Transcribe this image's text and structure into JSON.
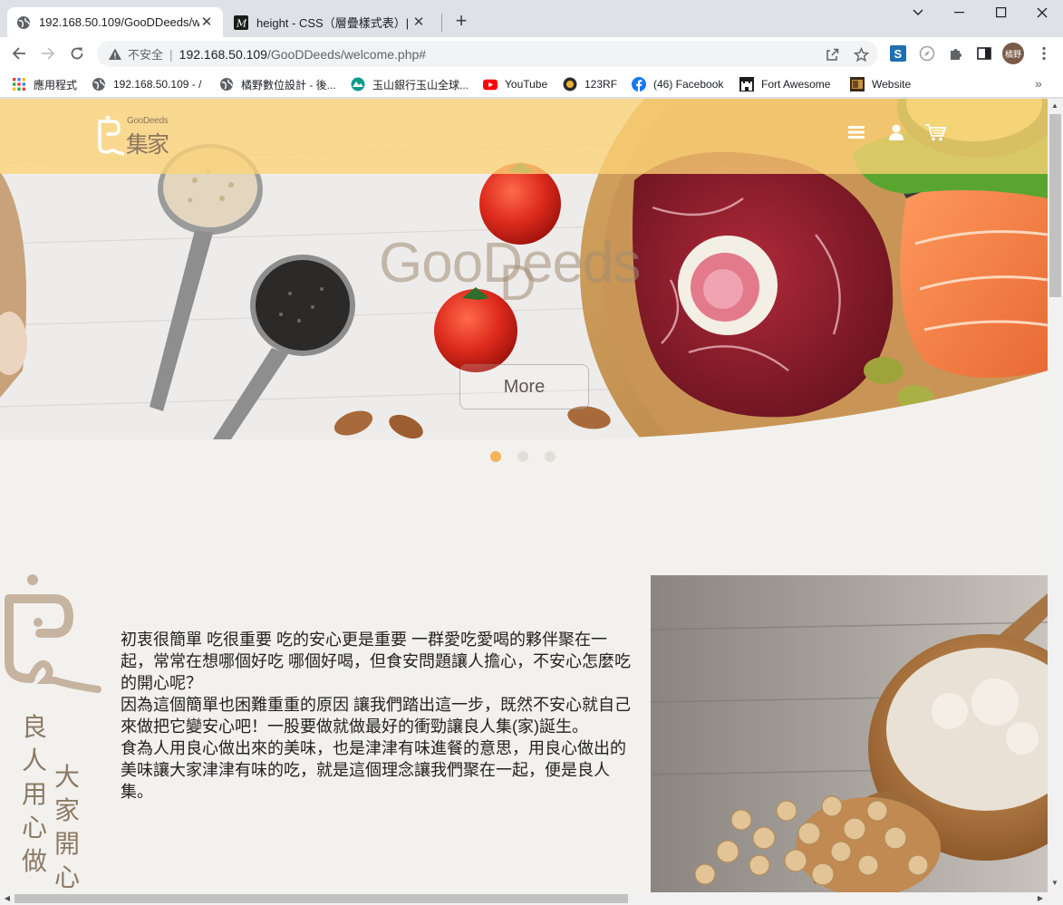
{
  "browser": {
    "tabs": [
      {
        "title": "192.168.50.109/GooDDeeds/we",
        "icon": "globe-icon",
        "active": true
      },
      {
        "title": "height - CSS（層疊樣式表）| M",
        "icon": "mdn-icon",
        "active": false
      }
    ],
    "new_tab_label": "+",
    "omnibox": {
      "security_label": "不安全",
      "host": "192.168.50.109",
      "path": "/GooDDeeds/welcome.php#"
    },
    "profile_label": "橘野",
    "bookmarks": [
      {
        "label": "應用程式",
        "icon": "apps-grid-icon"
      },
      {
        "label": "192.168.50.109 - /",
        "icon": "globe-icon"
      },
      {
        "label": "橘野數位設計 - 後...",
        "icon": "globe-icon"
      },
      {
        "label": "玉山銀行玉山全球...",
        "icon": "esun-bank-icon"
      },
      {
        "label": "YouTube",
        "icon": "youtube-icon"
      },
      {
        "label": "123RF",
        "icon": "123rf-icon"
      },
      {
        "label": "(46) Facebook",
        "icon": "facebook-icon"
      },
      {
        "label": "Fort Awesome",
        "icon": "fort-awesome-icon"
      },
      {
        "label": "Website",
        "icon": "website-icon"
      }
    ],
    "bookmarks_overflow": "»"
  },
  "page": {
    "logo": {
      "en": "GooDeeds",
      "zh": "集家"
    },
    "hero": {
      "title_main": "GooDeeds",
      "title_d": "D",
      "button_label": "More",
      "active_slide": 1,
      "slide_count": 3
    },
    "side_text": {
      "col1": "良人用心做",
      "col2": "大家開心"
    },
    "about": {
      "paragraphs": [
        "初衷很簡單 吃很重要 吃的安心更是重要 一群愛吃愛喝的夥伴聚在一起，常常在想哪個好吃 哪個好喝，但食安問題讓人擔心，不安心怎麼吃的開心呢？",
        "因為這個簡單也困難重重的原因 讓我們踏出這一步，既然不安心就自己來做把它變安心吧！一股要做就做最好的衝勁讓良人集(家)誕生。",
        "食為人用良心做出來的美味，也是津津有味進餐的意思，用良心做出的美味讓大家津津有味的吃，就是這個理念讓我們聚在一起，便是良人集。"
      ]
    },
    "colors": {
      "header": "#fcd276",
      "brand_brown": "#8c7760",
      "dot_active": "#f2b35a",
      "page_bg": "#f2f1ee"
    }
  }
}
